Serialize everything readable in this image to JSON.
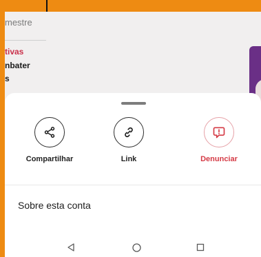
{
  "background": {
    "header": "mestre",
    "line1": "tivas",
    "line2": "nbater",
    "line3": "s"
  },
  "sheet": {
    "actions": [
      {
        "label": "Compartilhar",
        "icon": "share-icon"
      },
      {
        "label": "Link",
        "icon": "link-icon"
      },
      {
        "label": "Denunciar",
        "icon": "report-icon"
      }
    ],
    "about_label": "Sobre esta conta"
  },
  "nav": {
    "back_icon": "back-triangle-icon",
    "home_icon": "home-circle-icon",
    "recent_icon": "recent-apps-icon"
  },
  "colors": {
    "accent_orange": "#ee8b12",
    "danger": "#d53b46",
    "sheet_bg": "#ffffff"
  }
}
